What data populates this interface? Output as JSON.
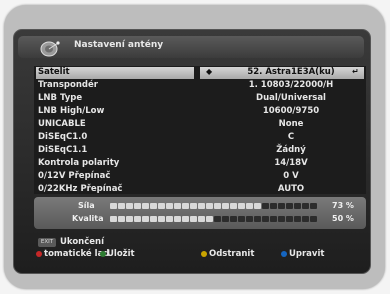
{
  "title": "Nastavení antény",
  "rows": [
    {
      "label": "Satelit",
      "value": "52. Astra1E3A(ku)"
    },
    {
      "label": "Transpondér",
      "value": "1. 10803/22000/H"
    },
    {
      "label": "LNB Type",
      "value": "Dual/Universal"
    },
    {
      "label": "LNB High/Low",
      "value": "10600/9750"
    },
    {
      "label": "UNICABLE",
      "value": "None"
    },
    {
      "label": "DiSEqC1.0",
      "value": "C"
    },
    {
      "label": "DiSEqC1.1",
      "value": "Žádný"
    },
    {
      "label": "Kontrola polarity",
      "value": "14/18V"
    },
    {
      "label": "0/12V Přepínač",
      "value": "0 V"
    },
    {
      "label": "0/22KHz Přepínač",
      "value": "AUTO"
    }
  ],
  "signal": {
    "strength_label": "Síla",
    "strength_pct": "73 %",
    "strength_value": 73,
    "quality_label": "Kvalita",
    "quality_pct": "50 %",
    "quality_value": 50
  },
  "footer": {
    "exit_key": "EXIT",
    "exit_label": "Ukončení",
    "auto_label": "tomatické lad",
    "save_label": "Uložit",
    "delete_label": "Odstranit",
    "edit_label": "Upravit"
  },
  "colors": {
    "red": "#c62828",
    "green": "#2e7d32",
    "yellow": "#c9a400",
    "blue": "#1565c0"
  }
}
